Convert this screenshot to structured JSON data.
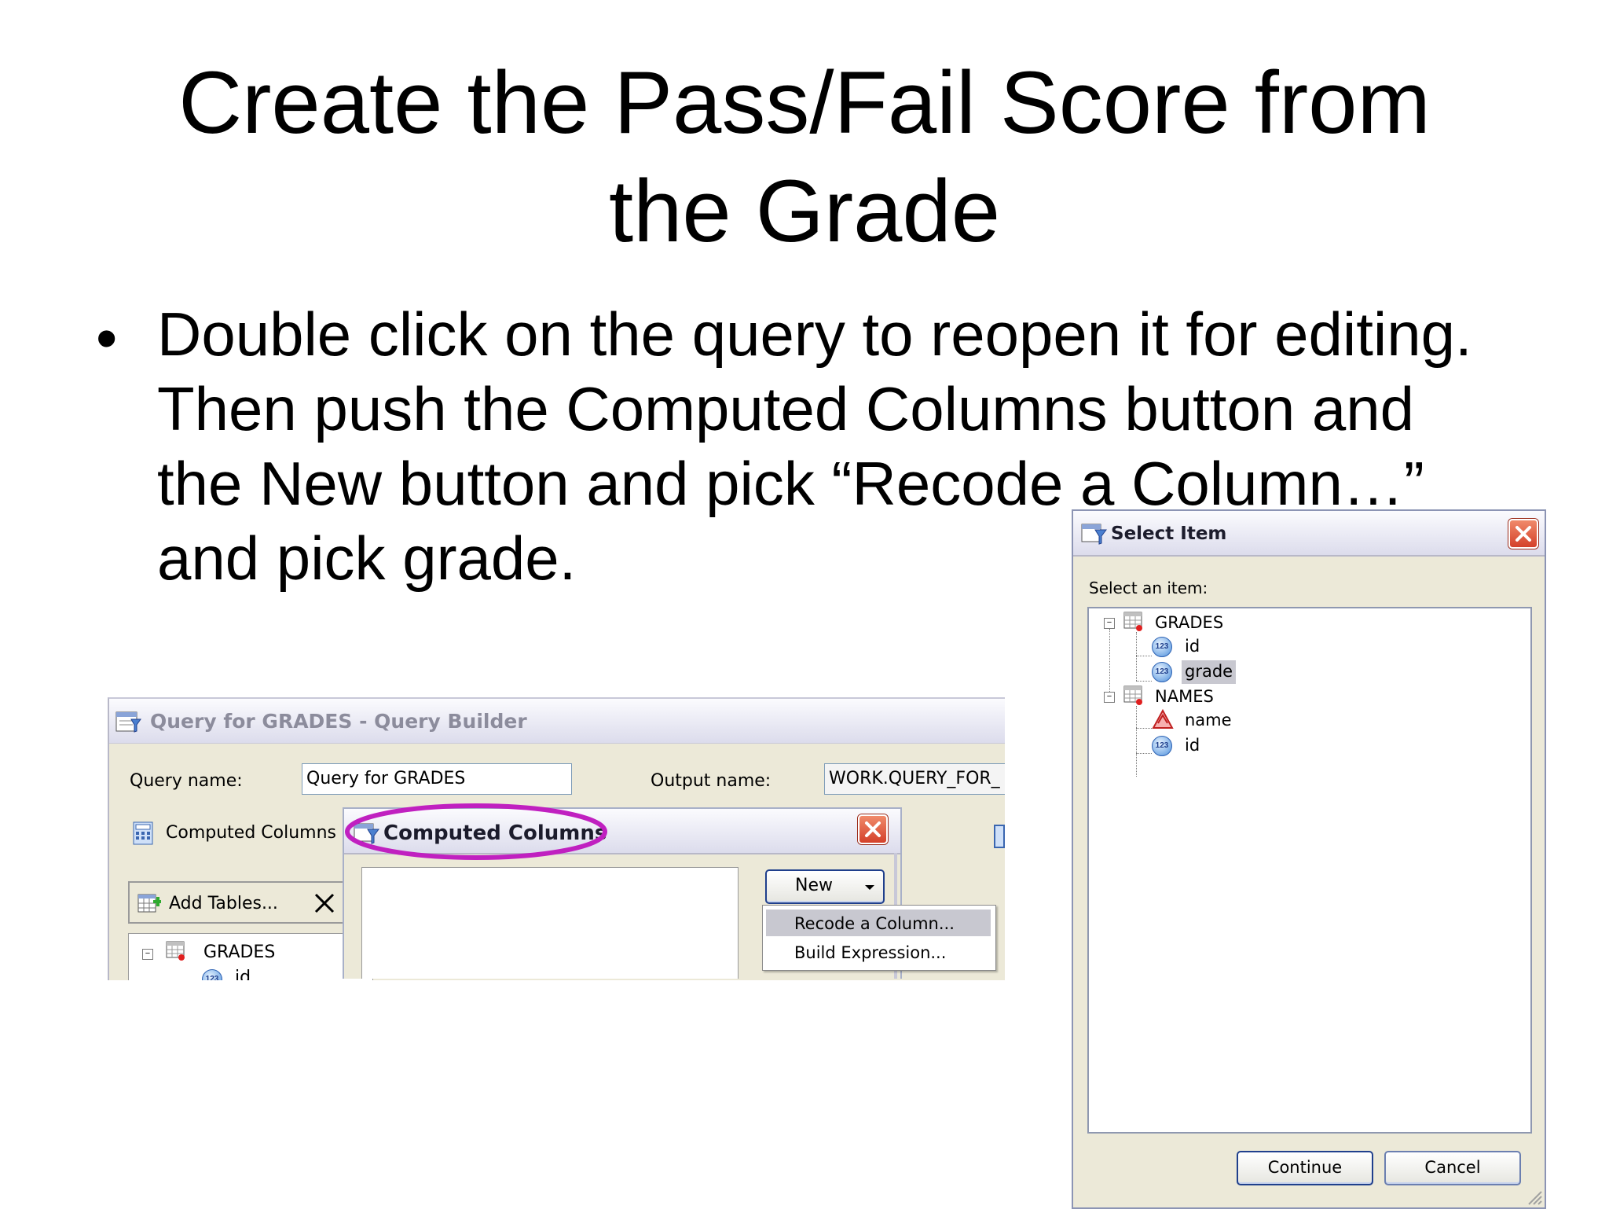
{
  "slide": {
    "title_line1": "Create the Pass/Fail Score from",
    "title_line2": "the Grade",
    "bullet_lines": [
      "Double click on the query to reopen it for editing.",
      "Then push the Computed Columns button and",
      "the New button and pick “Recode a Column…”",
      "and pick grade."
    ]
  },
  "query_builder": {
    "title": "Query for GRADES - Query Builder",
    "query_name_label": "Query name:",
    "query_name_value": "Query for GRADES",
    "output_name_label": "Output name:",
    "output_name_value": "WORK.QUERY_FOR_",
    "computed_columns_label": "Computed Columns",
    "add_tables_label": "Add Tables...",
    "tree": [
      {
        "label": "GRADES",
        "kind": "table"
      },
      {
        "label": "id",
        "kind": "numeric"
      }
    ]
  },
  "computed_columns": {
    "title": "Computed Columns",
    "new_button": "New",
    "menu": [
      {
        "label": "Recode a Column...",
        "selected": true
      },
      {
        "label": "Build Expression...",
        "selected": false
      }
    ],
    "highlight_color": "#c020c0"
  },
  "select_item": {
    "title": "Select Item",
    "prompt": "Select an item:",
    "tree": [
      {
        "label": "GRADES",
        "kind": "table",
        "level": 0
      },
      {
        "label": "id",
        "kind": "numeric",
        "level": 1
      },
      {
        "label": "grade",
        "kind": "numeric",
        "level": 1,
        "selected": true
      },
      {
        "label": "NAMES",
        "kind": "table",
        "level": 0
      },
      {
        "label": "name",
        "kind": "character",
        "level": 1
      },
      {
        "label": "id",
        "kind": "numeric",
        "level": 1
      }
    ],
    "continue_button": "Continue",
    "cancel_button": "Cancel"
  },
  "icons": {
    "window_icon": "query-window-icon",
    "table_icon": "table-icon",
    "numeric_icon": "numeric-column-icon",
    "character_icon": "character-column-icon",
    "close_icon": "close-icon",
    "delete_icon": "delete-x-icon",
    "calculator_icon": "computed-columns-icon",
    "add_table_icon": "add-table-icon",
    "dropdown_icon": "chevron-down-icon"
  },
  "colors": {
    "xp_button_border": "#1f3f8c",
    "close_red": "#d4402a",
    "selection_gray": "#c8c8d0"
  }
}
